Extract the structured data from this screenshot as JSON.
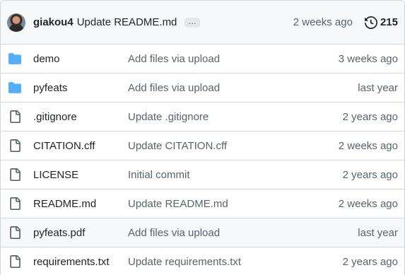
{
  "latest_commit": {
    "author": "giakou4",
    "message": "Update README.md",
    "ellipsis": "...",
    "time": "2 weeks ago",
    "history_count": "215"
  },
  "colors": {
    "folder": "#54aeff",
    "file_icon": "#59636e",
    "header_bg": "#f6f8fa",
    "border": "#d0d7de"
  },
  "files": [
    {
      "type": "folder",
      "icon": "folder-icon",
      "name": "demo",
      "message": "Add files via upload",
      "age": "3 weeks ago"
    },
    {
      "type": "folder",
      "icon": "folder-icon",
      "name": "pyfeats",
      "message": "Add files via upload",
      "age": "last year"
    },
    {
      "type": "file",
      "icon": "file-icon",
      "name": ".gitignore",
      "message": "Update .gitignore",
      "age": "2 years ago"
    },
    {
      "type": "file",
      "icon": "file-icon",
      "name": "CITATION.cff",
      "message": "Update CITATION.cff",
      "age": "2 weeks ago"
    },
    {
      "type": "file",
      "icon": "file-icon",
      "name": "LICENSE",
      "message": "Initial commit",
      "age": "2 years ago"
    },
    {
      "type": "file",
      "icon": "file-icon",
      "name": "README.md",
      "message": "Update README.md",
      "age": "2 weeks ago"
    },
    {
      "type": "file",
      "icon": "file-icon",
      "name": "pyfeats.pdf",
      "message": "Add files via upload",
      "age": "last year"
    },
    {
      "type": "file",
      "icon": "file-icon",
      "name": "requirements.txt",
      "message": "Update requirements.txt",
      "age": "2 years ago"
    }
  ]
}
